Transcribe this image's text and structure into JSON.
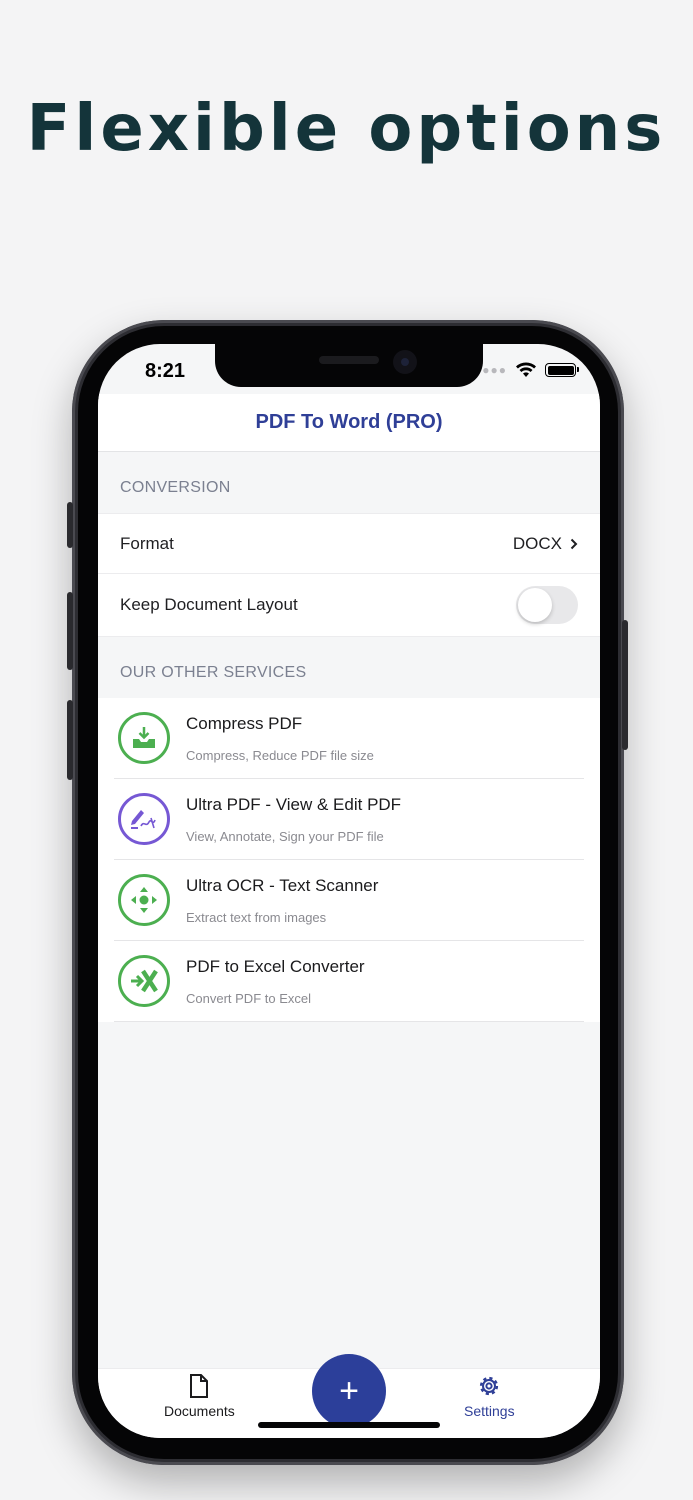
{
  "headline": "Flexible options",
  "status": {
    "time": "8:21"
  },
  "nav": {
    "title": "PDF To Word (PRO)"
  },
  "conversion": {
    "header": "CONVERSION",
    "format_label": "Format",
    "format_value": "DOCX",
    "layout_label": "Keep Document Layout",
    "layout_toggle_on": false
  },
  "services": {
    "header": "OUR OTHER SERVICES",
    "items": [
      {
        "title": "Compress PDF",
        "subtitle": "Compress, Reduce PDF file size",
        "icon": "compress-icon",
        "color": "#4caf50"
      },
      {
        "title": "Ultra PDF - View & Edit PDF",
        "subtitle": "View, Annotate, Sign your PDF file",
        "icon": "sign-pen-icon",
        "color": "#7658d4"
      },
      {
        "title": "Ultra OCR - Text Scanner",
        "subtitle": "Extract text from images",
        "icon": "scan-arrows-icon",
        "color": "#4caf50"
      },
      {
        "title": "PDF to Excel Converter",
        "subtitle": "Convert PDF to Excel",
        "icon": "excel-icon",
        "color": "#4caf50"
      }
    ]
  },
  "tabs": {
    "documents_label": "Documents",
    "settings_label": "Settings",
    "fab_label": "+"
  },
  "colors": {
    "accent": "#2f3f97",
    "green": "#4caf50",
    "purple": "#7658d4"
  }
}
